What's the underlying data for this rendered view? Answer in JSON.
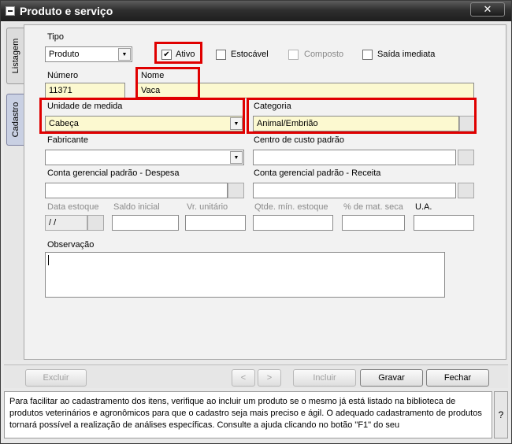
{
  "window": {
    "title": "Produto e serviço",
    "close_label": "✕"
  },
  "tabs": [
    {
      "label": "Listagem"
    },
    {
      "label": "Cadastro"
    }
  ],
  "form": {
    "tipo": {
      "label": "Tipo",
      "value": "Produto"
    },
    "ativo": {
      "label": "Ativo",
      "checked": "✔"
    },
    "estocavel": {
      "label": "Estocável"
    },
    "composto": {
      "label": "Composto"
    },
    "saida_imediata": {
      "label": "Saída imediata"
    },
    "numero": {
      "label": "Número",
      "value": "11371"
    },
    "nome": {
      "label": "Nome",
      "value": "Vaca"
    },
    "unidade": {
      "label": "Unidade de medida",
      "value": "Cabeça"
    },
    "categoria": {
      "label": "Categoria",
      "value": "Animal/Embrião"
    },
    "fabricante": {
      "label": "Fabricante",
      "value": ""
    },
    "centro_custo": {
      "label": "Centro de custo padrão",
      "value": ""
    },
    "conta_despesa": {
      "label": "Conta gerencial padrão - Despesa",
      "value": ""
    },
    "conta_receita": {
      "label": "Conta gerencial padrão - Receita",
      "value": ""
    },
    "data_estoque": {
      "label": "Data estoque",
      "value": " / /"
    },
    "saldo_inicial": {
      "label": "Saldo inicial"
    },
    "vr_unitario": {
      "label": "Vr. unitário"
    },
    "qtde_min": {
      "label": "Qtde. mín. estoque"
    },
    "pct_mat_seca": {
      "label": "% de mat. seca"
    },
    "ua": {
      "label": "U.A."
    },
    "observacao": {
      "label": "Observação",
      "value": ""
    }
  },
  "buttons": {
    "excluir": "Excluir",
    "prev": "<",
    "next": ">",
    "incluir": "Incluir",
    "gravar": "Gravar",
    "fechar": "Fechar"
  },
  "help": {
    "text": "Para facilitar ao cadastramento dos itens, verifique ao incluir um produto se o mesmo já está listado na biblioteca de produtos veterinários e agronômicos para que o cadastro seja mais preciso e ágil. O adequado cadastramento de produtos tornará possível a realização de análises específicas. Consulte a ajuda clicando no botão \"F1\" do seu",
    "question_label": "?"
  },
  "colors": {
    "highlight": "#e00000",
    "field_yellow": "#fcf9d0",
    "active_tab": "#c9d0e3"
  }
}
